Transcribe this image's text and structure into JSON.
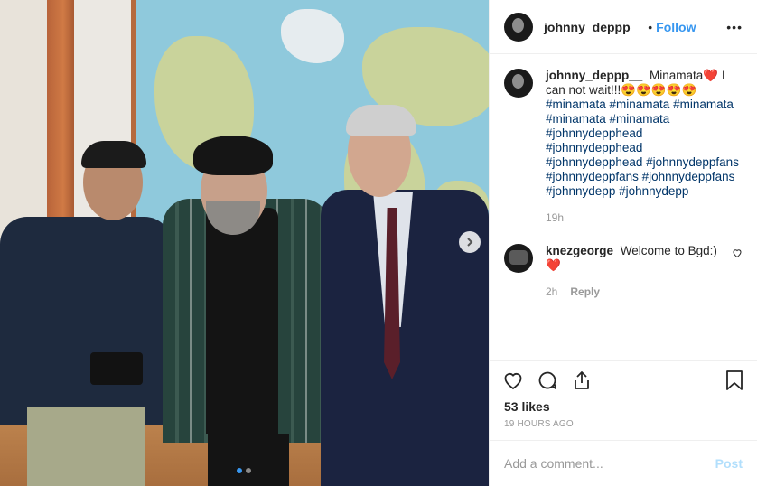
{
  "post": {
    "author": "johnny_deppp__",
    "separator": "•",
    "follow_label": "Follow",
    "more_label": "•••"
  },
  "caption": {
    "user": "johnny_deppp__",
    "text": "Minamata❤️ I can not wait!!!😍😍😍😍😍",
    "hashtags": "#minamata #minamata #minamata #minamata #minamata #johnnydepphead #johnnydepphead #johnnydepphead #johnnydeppfans #johnnydeppfans #johnnydeppfans #johnnydepp #johnnydepp",
    "time": "19h"
  },
  "comment": {
    "user": "knezgeorge",
    "text": "Welcome to Bgd:) ❤️",
    "time": "2h",
    "reply_label": "Reply"
  },
  "stats": {
    "likes": "53 likes",
    "posted": "19 HOURS AGO"
  },
  "composer": {
    "placeholder": "Add a comment...",
    "post_label": "Post"
  },
  "icons": {
    "like": "heart-icon",
    "comment": "comment-icon",
    "share": "share-icon",
    "save": "bookmark-icon",
    "next": "chevron-right-icon"
  },
  "colors": {
    "accent": "#3897f0",
    "post_disabled": "#b2dffc",
    "hashtag": "#003569",
    "like_red": "#ed4956"
  },
  "carousel": {
    "slides": 2,
    "active": 1
  }
}
